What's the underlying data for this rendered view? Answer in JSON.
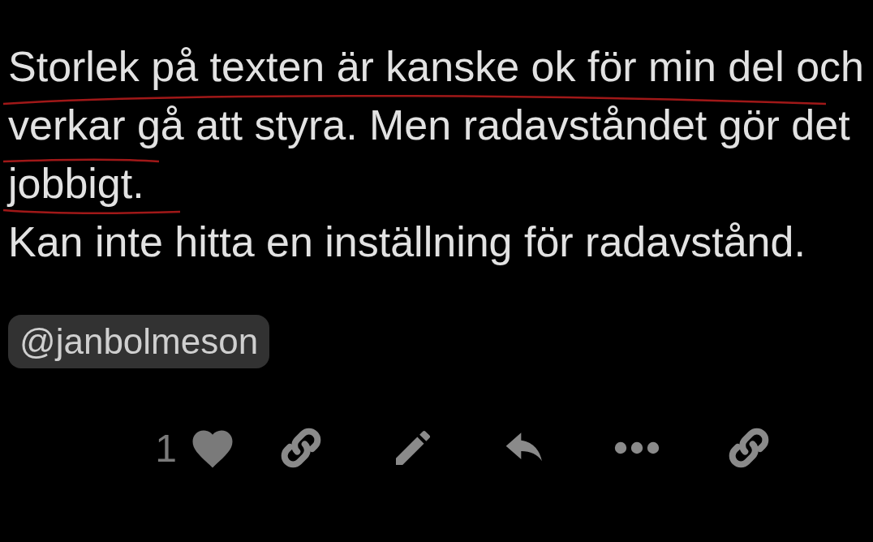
{
  "post": {
    "paragraphs": [
      "Storlek på texten är kanske ok för min del och",
      "verkar gå att styra. Men radavståndet gör det",
      "jobbigt.",
      "Kan inte hitta en inställning för radavstånd."
    ],
    "mention": "@janbolmeson",
    "actions": [
      {
        "kind": "like",
        "count": "1"
      },
      {
        "kind": "link"
      },
      {
        "kind": "edit"
      },
      {
        "kind": "reply"
      },
      {
        "kind": "more"
      },
      {
        "kind": "link"
      }
    ]
  }
}
